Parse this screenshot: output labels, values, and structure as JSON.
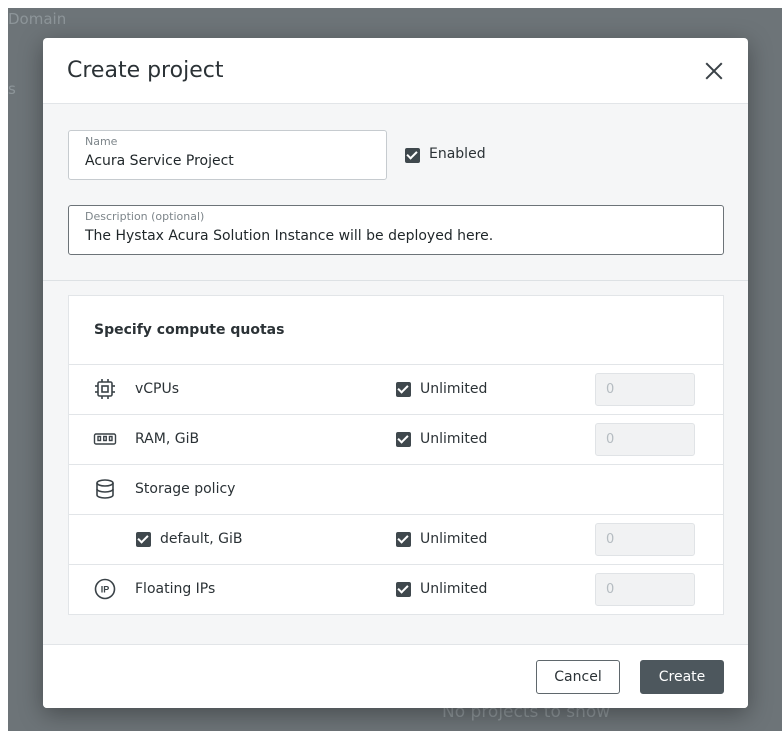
{
  "background": {
    "domain_text": "Domain",
    "side_text": "s",
    "empty_text": "No projects to show"
  },
  "modal": {
    "title": "Create project",
    "name_field": {
      "label": "Name",
      "value": "Acura Service Project"
    },
    "enabled_label": "Enabled",
    "description_field": {
      "label": "Description (optional)",
      "value": "The Hystax Acura Solution Instance will be deployed here."
    },
    "quotas": {
      "title": "Specify compute quotas",
      "rows": [
        {
          "label": "vCPUs",
          "icon": "cpu-icon",
          "unlimited_label": "Unlimited",
          "value": "0"
        },
        {
          "label": "RAM, GiB",
          "icon": "ram-icon",
          "unlimited_label": "Unlimited",
          "value": "0"
        },
        {
          "label": "Storage policy",
          "icon": "storage-icon"
        },
        {
          "label": "default, GiB",
          "unlimited_label": "Unlimited",
          "value": "0"
        },
        {
          "label": "Floating IPs",
          "icon": "floating-ip-icon",
          "unlimited_label": "Unlimited",
          "value": "0"
        }
      ]
    },
    "cancel_label": "Cancel",
    "create_label": "Create"
  }
}
